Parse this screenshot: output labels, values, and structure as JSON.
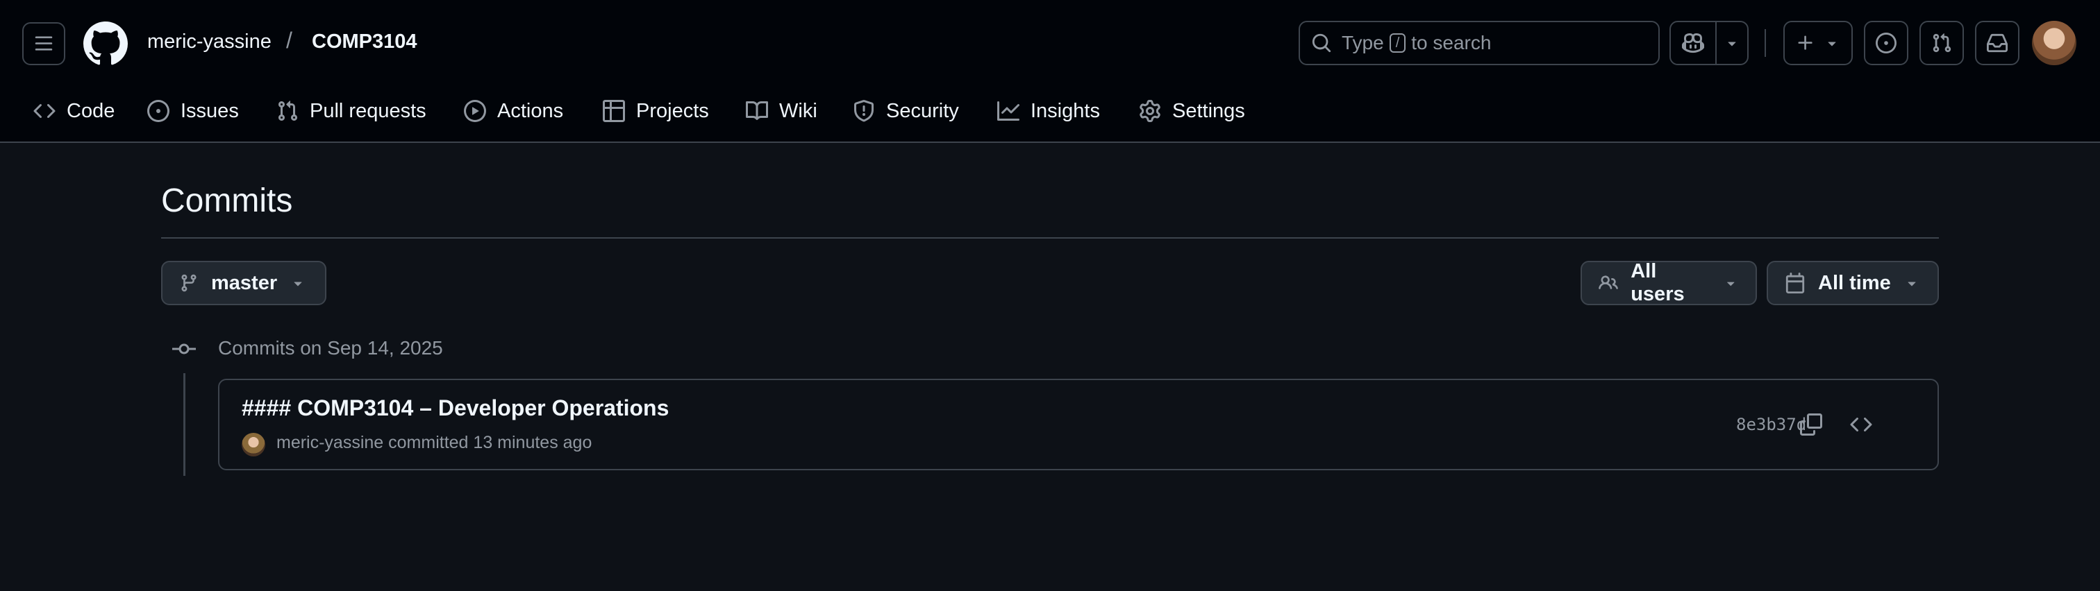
{
  "header": {
    "owner": "meric-yassine",
    "separator": "/",
    "repo": "COMP3104",
    "search": {
      "prefix": "Type",
      "key": "/",
      "suffix": "to search"
    }
  },
  "nav": {
    "items": [
      {
        "label": "Code",
        "icon": "code-icon"
      },
      {
        "label": "Issues",
        "icon": "issue-icon"
      },
      {
        "label": "Pull requests",
        "icon": "pull-request-icon"
      },
      {
        "label": "Actions",
        "icon": "play-icon"
      },
      {
        "label": "Projects",
        "icon": "table-icon"
      },
      {
        "label": "Wiki",
        "icon": "book-icon"
      },
      {
        "label": "Security",
        "icon": "shield-icon"
      },
      {
        "label": "Insights",
        "icon": "graph-icon"
      },
      {
        "label": "Settings",
        "icon": "gear-icon"
      }
    ]
  },
  "page": {
    "title": "Commits",
    "branch": "master",
    "users_filter": "All users",
    "time_filter": "All time"
  },
  "commit_groups": [
    {
      "label": "Commits on Sep 14, 2025",
      "commits": [
        {
          "message": "#### COMP3104 – Developer Operations",
          "author": "meric-yassine",
          "action": "committed 13 minutes ago",
          "sha": "8e3b37d"
        }
      ]
    }
  ],
  "colors": {
    "background": "#0d1117",
    "header_background": "#010409",
    "border": "#3d444d",
    "muted_text": "#9198a1",
    "text": "#f0f6fc"
  }
}
